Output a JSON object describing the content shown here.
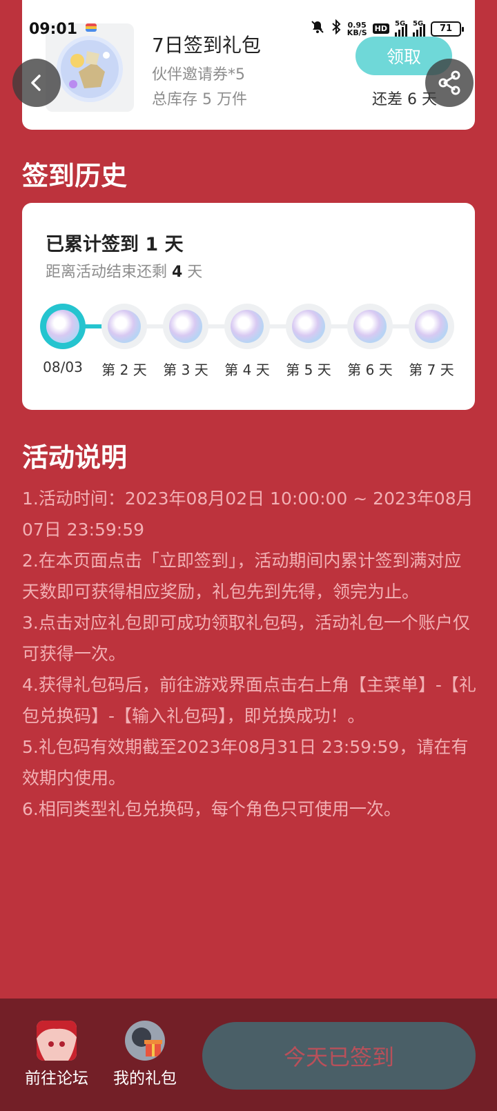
{
  "status_bar": {
    "time": "09:01",
    "speed_value": "0.95",
    "speed_unit": "KB/S",
    "hd_label": "HD",
    "signal_label_1": "5G",
    "signal_label_2": "5G",
    "battery": "71"
  },
  "gift": {
    "title": "7日签到礼包",
    "subtitle": "伙伴邀请券*5",
    "stock": "总库存 5 万件",
    "claim_label": "领取",
    "remain": "还差 6 天"
  },
  "history": {
    "section_title": "签到历史",
    "total_prefix": "已累计签到 ",
    "total_days": "1",
    "total_suffix": " 天",
    "remain_prefix": "距离活动结束还剩 ",
    "remain_days": "4",
    "remain_suffix": " 天",
    "days": [
      {
        "label": "08/03"
      },
      {
        "label": "第 2 天"
      },
      {
        "label": "第 3 天"
      },
      {
        "label": "第 4 天"
      },
      {
        "label": "第 5 天"
      },
      {
        "label": "第 6 天"
      },
      {
        "label": "第 7 天"
      }
    ]
  },
  "description": {
    "section_title": "活动说明",
    "items": [
      "1.活动时间：2023年08月02日 10:00:00 ~ 2023年08月07日 23:59:59",
      "2.在本页面点击「立即签到」，活动期间内累计签到满对应天数即可获得相应奖励，礼包先到先得，领完为止。",
      "3.点击对应礼包即可成功领取礼包码，活动礼包一个账户仅可获得一次。",
      "4.获得礼包码后，前往游戏界面点击右上角【主菜单】-【礼包兑换码】-【输入礼包码】，即兑换成功！。",
      "5.礼包码有效期截至2023年08月31日 23:59:59，请在有效期内使用。",
      "6.相同类型礼包兑换码，每个角色只可使用一次。"
    ]
  },
  "bottom": {
    "forum_label": "前往论坛",
    "gifts_label": "我的礼包",
    "signed_label": "今天已签到"
  }
}
